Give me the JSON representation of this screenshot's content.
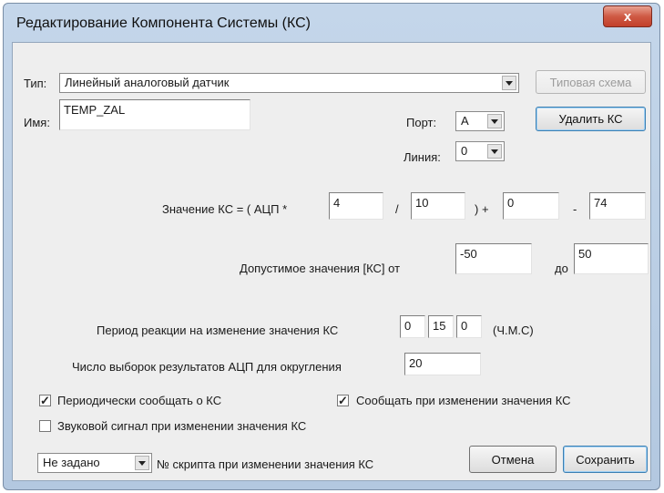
{
  "window": {
    "title": "Редактирование Компонента Системы (КС)",
    "close_glyph": "x"
  },
  "type": {
    "label": "Тип:",
    "value": "Линейный аналоговый датчик",
    "scheme_button": "Типовая схема"
  },
  "name": {
    "label": "Имя:",
    "value": "TEMP_ZAL"
  },
  "port": {
    "label": "Порт:",
    "value": "A"
  },
  "delete_button": "Удалить КС",
  "line": {
    "label": "Линия:",
    "value": "0"
  },
  "formula": {
    "prefix": "Значение КС = ( АЦП *",
    "mult": "4",
    "div_sign": "/",
    "div": "10",
    "plus_sign": ") +",
    "add": "0",
    "minus_sign": "-",
    "sub": "74"
  },
  "range": {
    "label": "Допустимое значения [КС]  от",
    "from": "-50",
    "to_label": "до",
    "to": "50"
  },
  "period": {
    "label": "Период реакции на изменение значения КС",
    "h": "0",
    "m": "15",
    "s": "0",
    "units": "(Ч.М.С)"
  },
  "samples": {
    "label": "Число выборок результатов АЦП для округления",
    "value": "20"
  },
  "checks": {
    "periodic": {
      "label": "Периодически сообщать о КС",
      "checked": true,
      "mark": "✓"
    },
    "on_change": {
      "label": "Сообщать при изменении значения КС",
      "checked": true,
      "mark": "✓"
    },
    "sound": {
      "label": "Звуковой сигнал при изменении значения КС",
      "checked": false,
      "mark": ""
    }
  },
  "script": {
    "value": "Не задано",
    "label": "№ скрипта при изменении значения КС"
  },
  "cancel_button": "Отмена",
  "save_button": "Сохранить"
}
